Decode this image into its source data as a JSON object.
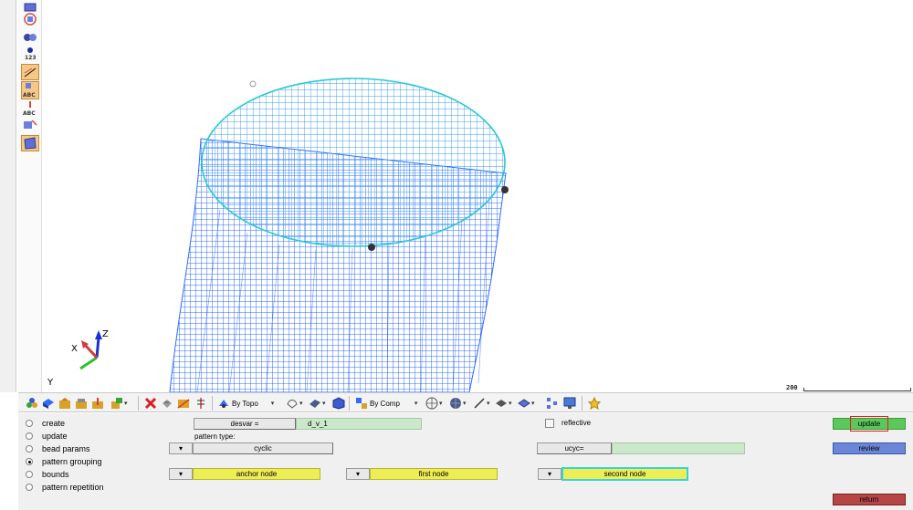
{
  "viewport": {
    "triad": {
      "x": "X",
      "y": "Y",
      "z": "Z"
    },
    "scale_label": "200"
  },
  "vtoolbar": {
    "items": [
      {
        "icon": "model-view-icon",
        "active": false
      },
      {
        "icon": "component-color-icon",
        "active": false
      },
      {
        "icon": "visualization-icon",
        "active": false
      },
      {
        "icon": "numbers-123-icon",
        "text": "123"
      },
      {
        "icon": "dimension-icon",
        "active": true
      },
      {
        "icon": "abc-label-icon",
        "text": "ABC",
        "active": true
      },
      {
        "icon": "abc-tag-icon",
        "text": "ABC"
      },
      {
        "icon": "node-tool-icon"
      },
      {
        "icon": "shade-mode-icon",
        "active": true
      }
    ]
  },
  "htoolbar": {
    "by_topo": "By Topo",
    "by_comp": "By Comp"
  },
  "panel": {
    "radios": [
      {
        "label": "create",
        "selected": false
      },
      {
        "label": "update",
        "selected": false
      },
      {
        "label": "bead params",
        "selected": false
      },
      {
        "label": "pattern grouping",
        "selected": true
      },
      {
        "label": "bounds",
        "selected": false
      },
      {
        "label": "pattern repetition",
        "selected": false
      }
    ],
    "desvar_label": "desvar =",
    "desvar_value": "d_v_1",
    "pattern_type_label": "pattern type:",
    "pattern_type_value": "cyclic",
    "anchor_node": "anchor node",
    "first_node": "first node",
    "second_node": "second node",
    "reflective_label": "reflective",
    "ucyc_label": "ucyc=",
    "update_btn": "update",
    "review_btn": "review",
    "return_btn": "return"
  },
  "colors": {
    "mesh_blue": "#2f6bff",
    "mesh_cyan": "#29c8d8",
    "green_btn": "#5cc85c",
    "yellow_btn": "#eded55",
    "red_btn": "#b64646",
    "blue_btn": "#6b86d6"
  }
}
